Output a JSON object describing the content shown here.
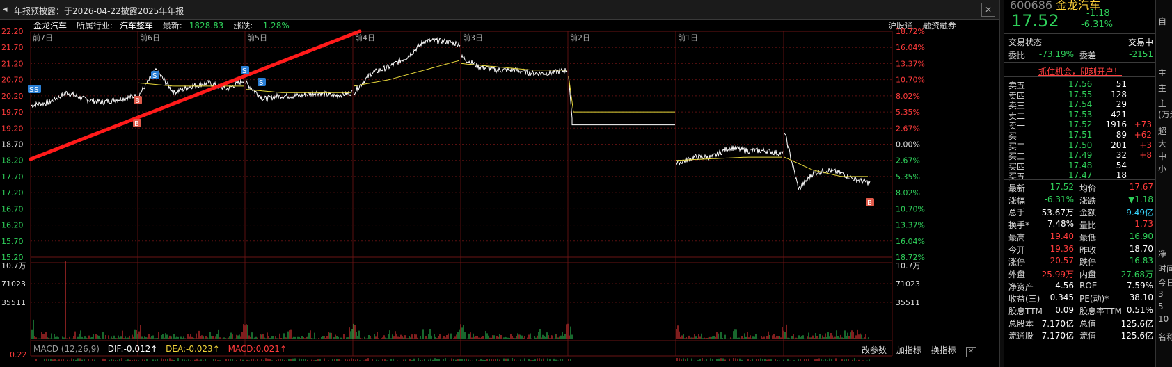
{
  "topbar": {
    "back_glyph": "◂",
    "notice": "年报预披露：于2026-04-22披露2025年年报",
    "close_glyph": "✕"
  },
  "header": {
    "stock_name": "金龙汽车",
    "industry_label": "所属行业:",
    "industry": "汽车整车",
    "latest_label": "最新:",
    "latest": "1828.83",
    "change_label": "涨跌:",
    "change": "-1.28%",
    "right_links": [
      "沪股通",
      "融资融券"
    ]
  },
  "day_labels": [
    "前7日",
    "前6日",
    "前5日",
    "前4日",
    "前3日",
    "前2日",
    "前1日"
  ],
  "price_axis": [
    "22.20",
    "21.70",
    "21.20",
    "20.70",
    "20.20",
    "19.70",
    "19.20",
    "18.70",
    "18.20",
    "17.70",
    "17.20",
    "16.70",
    "16.20",
    "15.70",
    "15.20"
  ],
  "pct_axis": [
    "18.72%",
    "16.04%",
    "13.37%",
    "10.70%",
    "8.02%",
    "5.35%",
    "2.67%",
    "0.00%",
    "2.67%",
    "5.35%",
    "8.02%",
    "10.70%",
    "13.37%",
    "16.04%",
    "18.72%"
  ],
  "volume_axis": [
    "10.7万",
    "71023",
    "35511"
  ],
  "macd_axis_top": "0.22",
  "markers": {
    "s": "S",
    "b": "B"
  },
  "macd": {
    "label": "MACD (12,26,9)",
    "dif": "DIF:-0.012↑",
    "dea": "DEA:-0.023↑",
    "macd": "MACD:0.021↑",
    "right_buttons": [
      "改参数",
      "加指标",
      "换指标"
    ],
    "close_glyph": "✕"
  },
  "colors": {
    "up": "#ff3b3b",
    "down": "#2fd05a",
    "price_line": "#ffffff",
    "avg_line": "#e8d83a",
    "trend_line": "#ff1a1a",
    "grid": "#5a1010"
  },
  "panel": {
    "code": "600686",
    "name": "金龙汽车",
    "price": "17.52",
    "change": "-1.18",
    "change_pct": "-6.31%",
    "status_label": "交易状态",
    "status_value": "交易中",
    "weibi_label": "委比",
    "weibi_value": "-73.19%",
    "weicha_label": "委差",
    "weicha_value": "-2151",
    "promo": "抓住机会，即刻开户！",
    "sells": [
      {
        "label": "卖五",
        "price": "17.56",
        "vol": "51",
        "delta": ""
      },
      {
        "label": "卖四",
        "price": "17.55",
        "vol": "128",
        "delta": ""
      },
      {
        "label": "卖三",
        "price": "17.54",
        "vol": "29",
        "delta": ""
      },
      {
        "label": "卖二",
        "price": "17.53",
        "vol": "421",
        "delta": ""
      },
      {
        "label": "卖一",
        "price": "17.52",
        "vol": "1916",
        "delta": "+73"
      }
    ],
    "buys": [
      {
        "label": "买一",
        "price": "17.51",
        "vol": "89",
        "delta": "+62"
      },
      {
        "label": "买二",
        "price": "17.50",
        "vol": "201",
        "delta": "+3"
      },
      {
        "label": "买三",
        "price": "17.49",
        "vol": "32",
        "delta": "+8"
      },
      {
        "label": "买四",
        "price": "17.48",
        "vol": "54",
        "delta": ""
      },
      {
        "label": "买五",
        "price": "17.47",
        "vol": "18",
        "delta": ""
      }
    ],
    "stats": [
      {
        "l1": "最新",
        "v1": "17.52",
        "l2": "均价",
        "v2": "17.67"
      },
      {
        "l1": "涨幅",
        "v1": "-6.31%",
        "l2": "涨跌",
        "v2": "▼1.18"
      },
      {
        "l1": "总手",
        "v1": "53.67万",
        "l2": "金额",
        "v2": "9.49亿"
      },
      {
        "l1": "换手*",
        "v1": "7.48%",
        "l2": "量比",
        "v2": "1.73"
      },
      {
        "l1": "最高",
        "v1": "19.40",
        "l2": "最低",
        "v2": "16.90"
      },
      {
        "l1": "今开",
        "v1": "19.36",
        "l2": "昨收",
        "v2": "18.70"
      },
      {
        "l1": "涨停",
        "v1": "20.57",
        "l2": "跌停",
        "v2": "16.83"
      },
      {
        "l1": "外盘",
        "v1": "25.99万",
        "l2": "内盘",
        "v2": "27.68万"
      },
      {
        "l1": "净资产",
        "v1": "4.56",
        "l2": "ROE",
        "v2": "7.59%"
      },
      {
        "l1": "收益(三)",
        "v1": "0.345",
        "l2": "PE(动)*",
        "v2": "38.10"
      },
      {
        "l1": "股息TTM",
        "v1": "0.09",
        "l2": "股息率TTM",
        "v2": "0.51%"
      },
      {
        "l1": "总股本",
        "v1": "7.170亿",
        "l2": "总值",
        "v2": "125.6亿"
      },
      {
        "l1": "流通股",
        "v1": "7.170亿",
        "l2": "流值",
        "v2": "125.6亿"
      }
    ]
  },
  "edge_labels": [
    "自",
    "主",
    "主",
    "主",
    "(万元)",
    "超",
    "大",
    "中",
    "小",
    "净",
    "时间",
    "今日",
    "3",
    "5",
    "10",
    "名称"
  ]
}
